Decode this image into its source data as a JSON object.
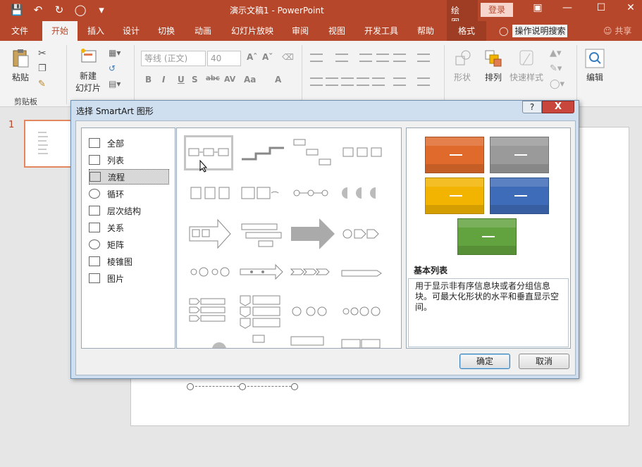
{
  "titlebar": {
    "doc_title": "演示文稿1  -  PowerPoint",
    "context_group": "绘图...",
    "login_label": "登录",
    "restore_icon": "restore-icon",
    "minimize_icon": "minimize-icon",
    "maximize_icon": "maximize-icon",
    "close_icon": "close-icon"
  },
  "tabs": [
    {
      "label": "文件"
    },
    {
      "label": "开始"
    },
    {
      "label": "插入"
    },
    {
      "label": "设计"
    },
    {
      "label": "切换"
    },
    {
      "label": "动画"
    },
    {
      "label": "幻灯片放映"
    },
    {
      "label": "审阅"
    },
    {
      "label": "视图"
    },
    {
      "label": "开发工具"
    },
    {
      "label": "帮助"
    },
    {
      "label": "格式"
    }
  ],
  "tellme": {
    "label": "操作说明搜索",
    "icon": "lightbulb-icon"
  },
  "share_label": "共享",
  "ribbon": {
    "paste_label": "粘贴",
    "new_slide_label_1": "新建",
    "new_slide_label_2": "幻灯片",
    "font_name": "等线 (正文)",
    "font_size": "40",
    "shape_label": "形状",
    "arrange_label": "排列",
    "quick_style_label": "快速样式",
    "edit_label": "编辑",
    "clipboard_group": "剪贴板"
  },
  "thumbnail": {
    "number": "1"
  },
  "dialog": {
    "title": "选择 SmartArt 图形",
    "help_label": "?",
    "close_label": "X",
    "categories": [
      {
        "label": "全部",
        "icon": "all-icon"
      },
      {
        "label": "列表",
        "icon": "list-icon"
      },
      {
        "label": "流程",
        "icon": "process-icon"
      },
      {
        "label": "循环",
        "icon": "cycle-icon"
      },
      {
        "label": "层次结构",
        "icon": "hierarchy-icon"
      },
      {
        "label": "关系",
        "icon": "relationship-icon"
      },
      {
        "label": "矩阵",
        "icon": "matrix-icon"
      },
      {
        "label": "棱锥图",
        "icon": "pyramid-icon"
      },
      {
        "label": "图片",
        "icon": "picture-icon"
      }
    ],
    "preview_title": "基本列表",
    "preview_desc": "用于显示非有序信息块或者分组信息块。可最大化形状的水平和垂直显示空间。",
    "preview_colors": [
      "#e06a2c",
      "#9a9a9a",
      "#f2b400",
      "#3f6cb8",
      "#63a33f"
    ],
    "ok_label": "确定",
    "cancel_label": "取消"
  }
}
